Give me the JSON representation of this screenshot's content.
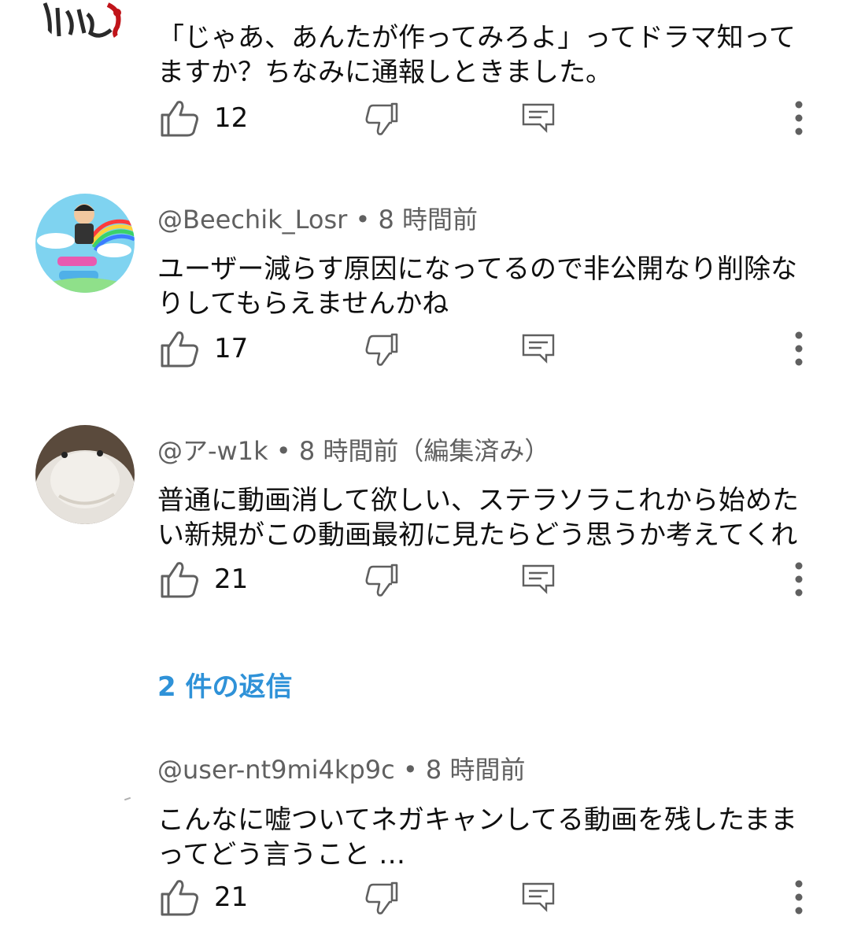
{
  "comments": [
    {
      "author": "",
      "time": "",
      "text": "「じゃあ、あんたが作ってみろよ」ってドラマ知ってますか？ちなみに通報しときました。",
      "likes": "12"
    },
    {
      "author": "@Beechik_Losr",
      "time": "8 時間前",
      "text": "ユーザー減らす原因になってるので非公開なり削除なりしてもらえませんかね",
      "likes": "17"
    },
    {
      "author": "@ア-w1k",
      "time": "8 時間前（編集済み）",
      "text": "普通に動画消して欲しい、ステラソラこれから始めたい新規がこの動画最初に見たらどう思うか考えてくれ",
      "likes": "21"
    },
    {
      "author": "@user-nt9mi4kp9c",
      "time": "8 時間前",
      "text": "こんなに嘘ついてネガキャンしてる動画を残したままってどう言うこと …",
      "likes": "21"
    }
  ],
  "separator": " • ",
  "replies_link": "2 件の返信",
  "colors": {
    "link": "#2f92d8",
    "meta": "#606060",
    "text": "#0f0f0f",
    "icon": "#606060"
  },
  "icons": [
    "thumb-up-icon",
    "thumb-down-icon",
    "reply-icon",
    "more-vert-icon"
  ]
}
